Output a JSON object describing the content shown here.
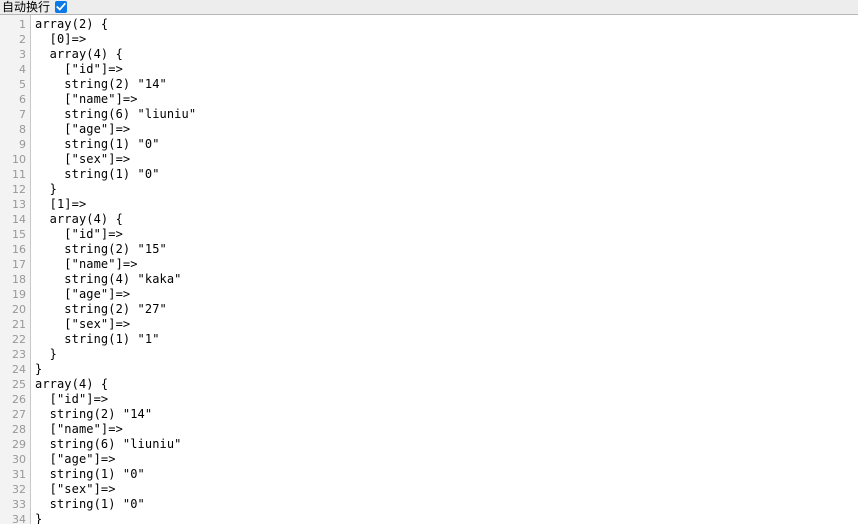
{
  "toolbar": {
    "wrap_label": "自动换行",
    "wrap_checked": true,
    "checkbox_color": "#0b79e8"
  },
  "editor": {
    "gutter_bg": "#f3f3f3",
    "code_bg": "#ffffff",
    "lineno_color": "#989898",
    "text_color": "#000000",
    "first_line": 1,
    "last_line": 34,
    "lines": [
      {
        "n": "1",
        "text": "array(2) {"
      },
      {
        "n": "2",
        "text": "  [0]=>"
      },
      {
        "n": "3",
        "text": "  array(4) {"
      },
      {
        "n": "4",
        "text": "    [\"id\"]=>"
      },
      {
        "n": "5",
        "text": "    string(2) \"14\""
      },
      {
        "n": "6",
        "text": "    [\"name\"]=>"
      },
      {
        "n": "7",
        "text": "    string(6) \"liuniu\""
      },
      {
        "n": "8",
        "text": "    [\"age\"]=>"
      },
      {
        "n": "9",
        "text": "    string(1) \"0\""
      },
      {
        "n": "10",
        "text": "    [\"sex\"]=>"
      },
      {
        "n": "11",
        "text": "    string(1) \"0\""
      },
      {
        "n": "12",
        "text": "  }"
      },
      {
        "n": "13",
        "text": "  [1]=>"
      },
      {
        "n": "14",
        "text": "  array(4) {"
      },
      {
        "n": "15",
        "text": "    [\"id\"]=>"
      },
      {
        "n": "16",
        "text": "    string(2) \"15\""
      },
      {
        "n": "17",
        "text": "    [\"name\"]=>"
      },
      {
        "n": "18",
        "text": "    string(4) \"kaka\""
      },
      {
        "n": "19",
        "text": "    [\"age\"]=>"
      },
      {
        "n": "20",
        "text": "    string(2) \"27\""
      },
      {
        "n": "21",
        "text": "    [\"sex\"]=>"
      },
      {
        "n": "22",
        "text": "    string(1) \"1\""
      },
      {
        "n": "23",
        "text": "  }"
      },
      {
        "n": "24",
        "text": "}"
      },
      {
        "n": "25",
        "text": "array(4) {"
      },
      {
        "n": "26",
        "text": "  [\"id\"]=>"
      },
      {
        "n": "27",
        "text": "  string(2) \"14\""
      },
      {
        "n": "28",
        "text": "  [\"name\"]=>"
      },
      {
        "n": "29",
        "text": "  string(6) \"liuniu\""
      },
      {
        "n": "30",
        "text": "  [\"age\"]=>"
      },
      {
        "n": "31",
        "text": "  string(1) \"0\""
      },
      {
        "n": "32",
        "text": "  [\"sex\"]=>"
      },
      {
        "n": "33",
        "text": "  string(1) \"0\""
      },
      {
        "n": "34",
        "text": "}"
      }
    ]
  }
}
